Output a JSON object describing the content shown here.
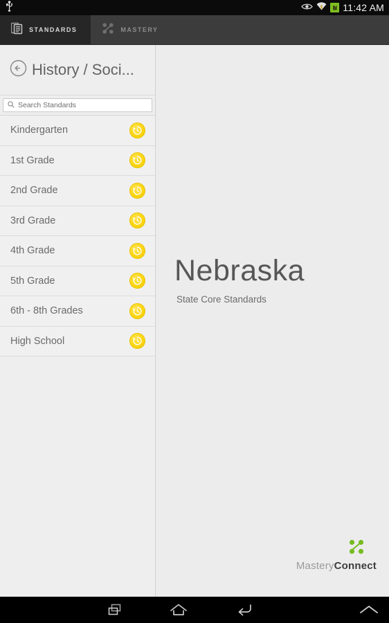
{
  "statusbar": {
    "usb_icon": "usb-icon",
    "eye_icon": "eye-icon",
    "wifi_icon": "wifi-icon",
    "battery_icon": "battery-icon",
    "clock": "11:42 AM"
  },
  "tabs": [
    {
      "label": "STANDARDS",
      "icon": "documents-icon",
      "active": true
    },
    {
      "label": "MASTERY",
      "icon": "network-nodes-icon",
      "active": false
    }
  ],
  "sidebar": {
    "back_icon": "back-arrow-circle-icon",
    "title": "History / Soci...",
    "search": {
      "icon": "search-icon",
      "placeholder": "Search Standards",
      "value": ""
    },
    "grades": [
      {
        "label": "Kindergarten",
        "badge_icon": "history-clock-icon"
      },
      {
        "label": "1st Grade",
        "badge_icon": "history-clock-icon"
      },
      {
        "label": "2nd Grade",
        "badge_icon": "history-clock-icon"
      },
      {
        "label": "3rd Grade",
        "badge_icon": "history-clock-icon"
      },
      {
        "label": "4th Grade",
        "badge_icon": "history-clock-icon"
      },
      {
        "label": "5th Grade",
        "badge_icon": "history-clock-icon"
      },
      {
        "label": "6th - 8th Grades",
        "badge_icon": "history-clock-icon"
      },
      {
        "label": "High School",
        "badge_icon": "history-clock-icon"
      }
    ]
  },
  "main": {
    "state_name": "Nebraska",
    "state_subtitle": "State Core Standards",
    "brand": {
      "mark_icon": "masteryconnect-nodes-icon",
      "name_light": "Mastery",
      "name_bold": "Connect"
    }
  },
  "navbar": {
    "recent_label": "recent-apps-icon",
    "home_label": "home-icon",
    "back_label": "back-icon",
    "up_label": "chevron-up-icon"
  },
  "colors": {
    "badge_yellow": "#fdd714",
    "brand_green": "#76bc21",
    "tab_active_bg": "#262626",
    "tab_bar_bg": "#3c3c3c",
    "sidebar_bg": "#f1f0f1",
    "main_bg": "#ececec"
  }
}
